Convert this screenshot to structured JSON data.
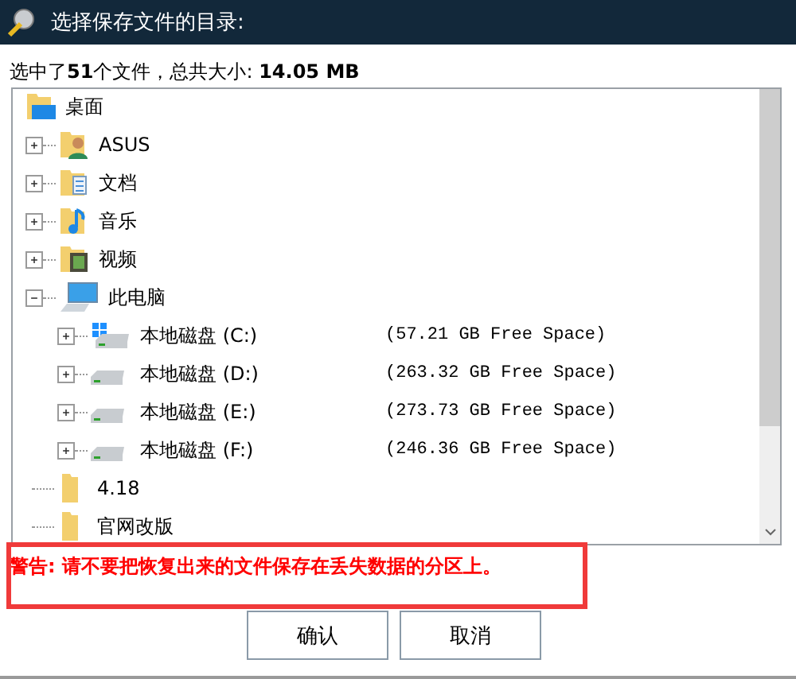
{
  "window": {
    "title": "选择保存文件的目录:"
  },
  "summary": "选中了**51**个文件，总共大小: **14.05 MB**",
  "tree": {
    "label": "桌面",
    "kind": "desktop",
    "children": [
      {
        "label": "ASUS",
        "kind": "user",
        "expanded": false
      },
      {
        "label": "文档",
        "kind": "documents",
        "expanded": false
      },
      {
        "label": "音乐",
        "kind": "music",
        "expanded": false
      },
      {
        "label": "视频",
        "kind": "video",
        "expanded": false
      },
      {
        "label": "此电脑",
        "kind": "computer",
        "expanded": true,
        "children": [
          {
            "label": "本地磁盘 (C:)",
            "kind": "system-drive",
            "expanded": false,
            "free": "(57.21 GB Free Space)"
          },
          {
            "label": "本地磁盘 (D:)",
            "kind": "drive",
            "expanded": false,
            "free": "(263.32 GB Free Space)"
          },
          {
            "label": "本地磁盘 (E:)",
            "kind": "drive",
            "expanded": false,
            "free": "(273.73 GB Free Space)"
          },
          {
            "label": "本地磁盘 (F:)",
            "kind": "drive",
            "expanded": false,
            "free": "(246.36 GB Free Space)"
          }
        ]
      },
      {
        "label": "4.18",
        "kind": "folder"
      },
      {
        "label": "官网改版",
        "kind": "folder"
      }
    ]
  },
  "warning": "警告: 请不要把恢复出来的文件保存在丢失数据的分区上。",
  "buttons": [
    "确认",
    "取消"
  ]
}
